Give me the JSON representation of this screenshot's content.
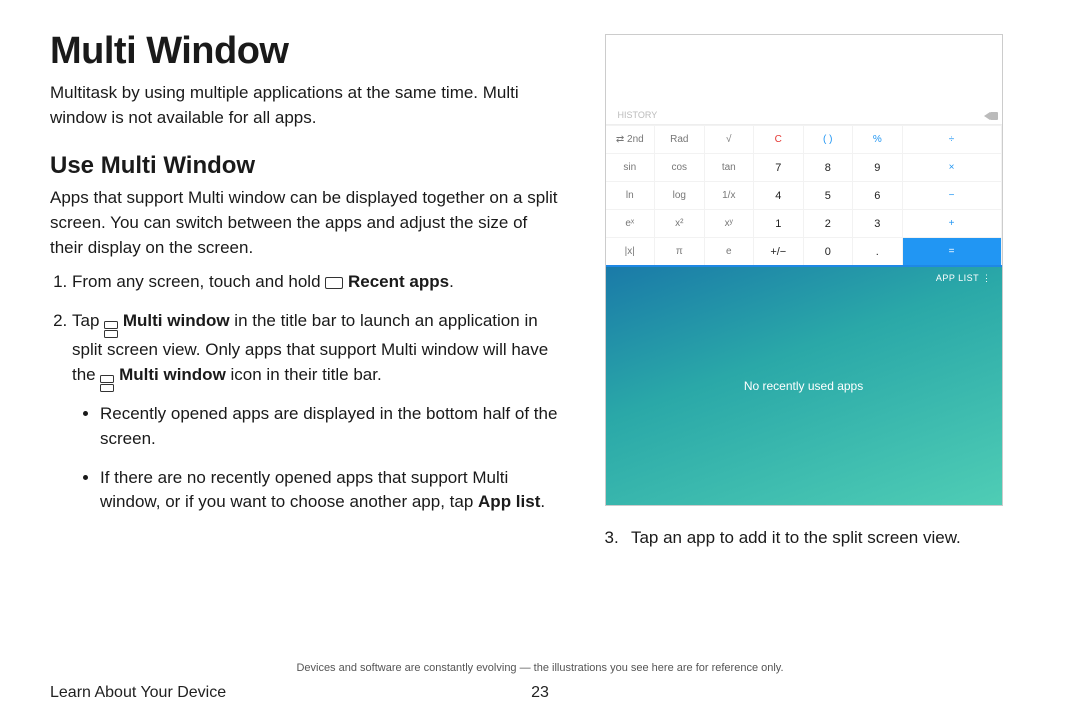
{
  "heading": "Multi Window",
  "intro": "Multitask by using multiple applications at the same time. Multi window is not available for all apps.",
  "section_heading": "Use Multi Window",
  "section_intro": "Apps that support Multi window can be displayed together on a split screen. You can switch between the apps and adjust the size of their display on the screen.",
  "steps": {
    "s1_pre": "From any screen, touch and hold ",
    "s1_bold": "Recent apps",
    "s1_post": ".",
    "s2_pre": "Tap ",
    "s2_bold1": "Multi window",
    "s2_mid1": " in the title bar to launch an application in split screen view. Only apps that support Multi window will have the ",
    "s2_bold2": "Multi window",
    "s2_post": " icon in their title bar.",
    "bullet1": "Recently opened apps are displayed in the bottom half of the screen.",
    "bullet2_pre": "If there are no recently opened apps that support Multi window, or if you want to choose another app, tap ",
    "bullet2_bold": "App list",
    "bullet2_post": ".",
    "s3_num": "3.",
    "s3_text": "Tap an app to add it to the split screen view."
  },
  "mock": {
    "history_label": "HISTORY",
    "rows": [
      [
        "⇄ 2nd",
        "Rad",
        "√",
        "C",
        "( )",
        "%",
        "÷"
      ],
      [
        "sin",
        "cos",
        "tan",
        "7",
        "8",
        "9",
        "×"
      ],
      [
        "ln",
        "log",
        "1/x",
        "4",
        "5",
        "6",
        "−"
      ],
      [
        "eˣ",
        "x²",
        "xʸ",
        "1",
        "2",
        "3",
        "+"
      ],
      [
        "|x|",
        "π",
        "e",
        "+/−",
        "0",
        ".",
        "="
      ]
    ],
    "app_list": "APP LIST   ⋮",
    "no_recent": "No recently used apps"
  },
  "fineprint": "Devices and software are constantly evolving — the illustrations you see here are for reference only.",
  "footer_section": "Learn About Your Device",
  "page_number": "23"
}
